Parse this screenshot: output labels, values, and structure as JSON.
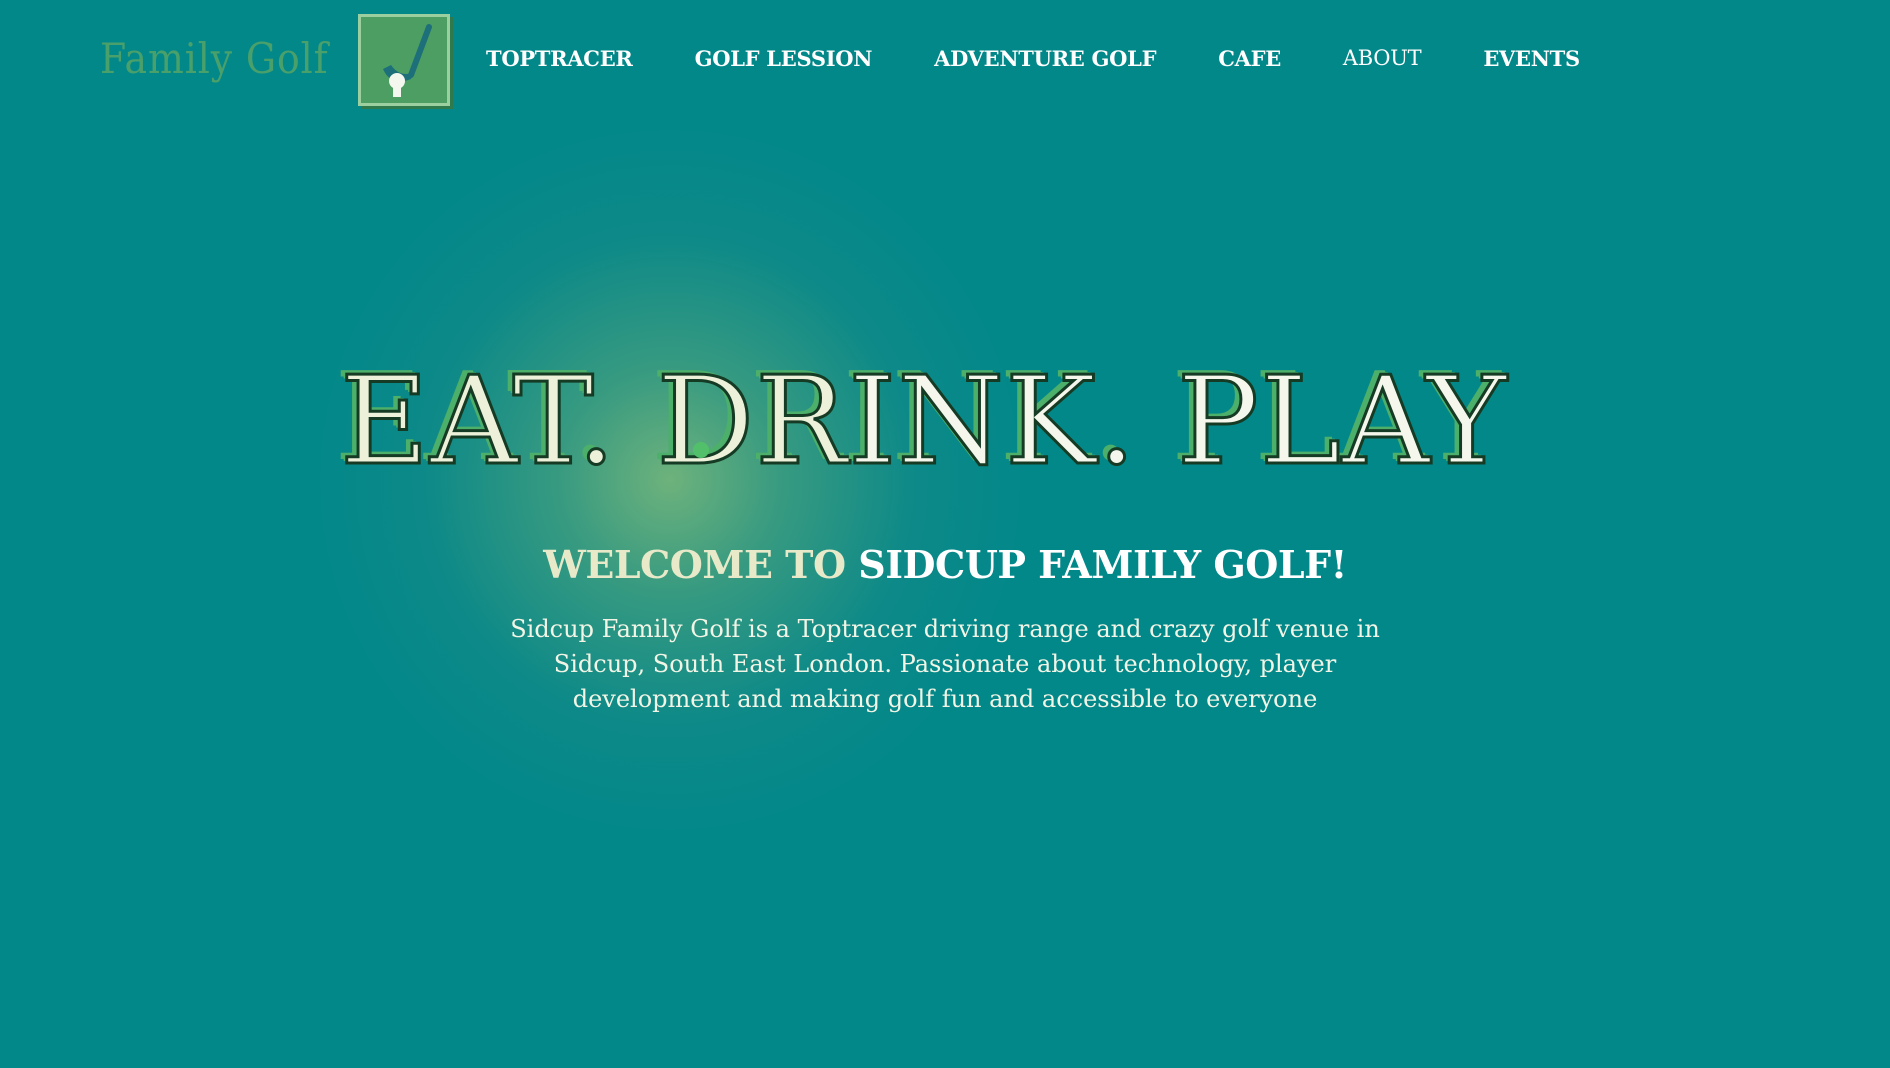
{
  "brand": {
    "name": "Family Golf"
  },
  "nav": {
    "items": [
      {
        "label": "TOPTRACER"
      },
      {
        "label": "GOLF LESSION"
      },
      {
        "label": "ADVENTURE GOLF"
      },
      {
        "label": "CAFE"
      },
      {
        "label": "ABOUT"
      },
      {
        "label": "EVENTS"
      }
    ]
  },
  "hero": {
    "title_part1": "EAT. DR",
    "title_part2": "INK. PLAY",
    "welcome_part1": "WELCOME TO ",
    "welcome_part2": "SIDCUP FAMILY GOLF!",
    "intro": "Sidcup Family Golf is a Toptracer driving range and crazy golf venue in Sidcup, South East London. Passionate about technology, player development and making golf fun and accessible to everyone"
  },
  "colors": {
    "background": "#03888a",
    "brand_green": "#4caf6a",
    "text": "#ffffff"
  }
}
